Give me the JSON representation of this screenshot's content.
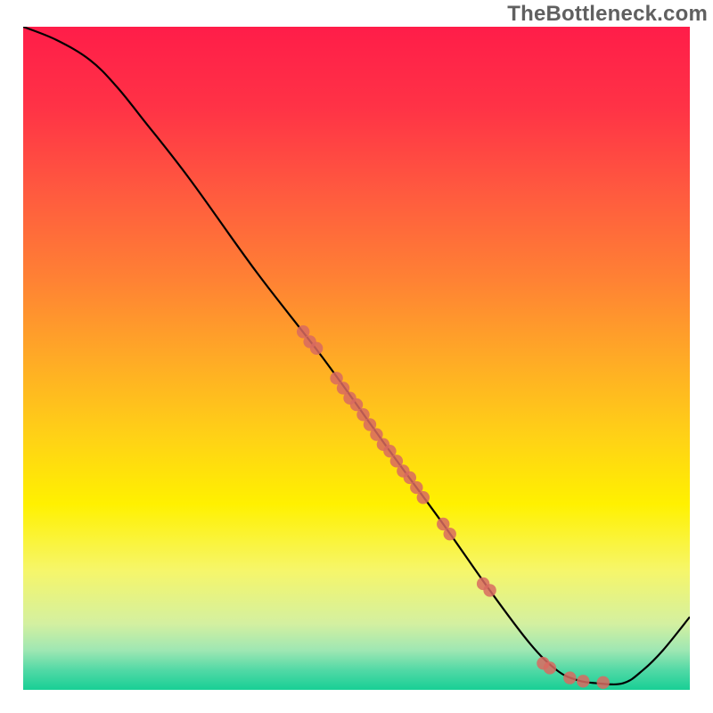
{
  "watermark": "TheBottleneck.com",
  "chart_data": {
    "type": "line",
    "title": "",
    "xlabel": "",
    "ylabel": "",
    "xlim": [
      0,
      100
    ],
    "ylim": [
      0,
      100
    ],
    "background": {
      "type": "vertical-gradient",
      "stops": [
        {
          "offset": 0.0,
          "color": "#ff1d49"
        },
        {
          "offset": 0.12,
          "color": "#ff3246"
        },
        {
          "offset": 0.25,
          "color": "#ff5a3f"
        },
        {
          "offset": 0.38,
          "color": "#ff8134"
        },
        {
          "offset": 0.5,
          "color": "#ffaa26"
        },
        {
          "offset": 0.62,
          "color": "#ffd216"
        },
        {
          "offset": 0.72,
          "color": "#fff100"
        },
        {
          "offset": 0.82,
          "color": "#f6f66a"
        },
        {
          "offset": 0.9,
          "color": "#d4f0a0"
        },
        {
          "offset": 0.94,
          "color": "#9fe7b3"
        },
        {
          "offset": 0.97,
          "color": "#52d9a6"
        },
        {
          "offset": 1.0,
          "color": "#18cf95"
        }
      ]
    },
    "series": [
      {
        "name": "bottleneck-curve",
        "type": "line",
        "color": "#000000",
        "points": [
          {
            "x": 0,
            "y": 100
          },
          {
            "x": 5,
            "y": 98
          },
          {
            "x": 10,
            "y": 95
          },
          {
            "x": 14,
            "y": 91
          },
          {
            "x": 18,
            "y": 86
          },
          {
            "x": 25,
            "y": 77
          },
          {
            "x": 35,
            "y": 63
          },
          {
            "x": 45,
            "y": 50
          },
          {
            "x": 55,
            "y": 36
          },
          {
            "x": 63,
            "y": 25
          },
          {
            "x": 70,
            "y": 15
          },
          {
            "x": 76,
            "y": 7
          },
          {
            "x": 80,
            "y": 3
          },
          {
            "x": 83,
            "y": 1.5
          },
          {
            "x": 86,
            "y": 1
          },
          {
            "x": 90,
            "y": 1
          },
          {
            "x": 93,
            "y": 3
          },
          {
            "x": 96,
            "y": 6
          },
          {
            "x": 100,
            "y": 11
          }
        ]
      },
      {
        "name": "sample-markers",
        "type": "scatter",
        "color": "#d86a60",
        "points": [
          {
            "x": 42,
            "y": 54
          },
          {
            "x": 43,
            "y": 52.5
          },
          {
            "x": 44,
            "y": 51.5
          },
          {
            "x": 47,
            "y": 47
          },
          {
            "x": 48,
            "y": 45.5
          },
          {
            "x": 49,
            "y": 44
          },
          {
            "x": 50,
            "y": 43
          },
          {
            "x": 51,
            "y": 41.5
          },
          {
            "x": 52,
            "y": 40
          },
          {
            "x": 53,
            "y": 38.5
          },
          {
            "x": 54,
            "y": 37
          },
          {
            "x": 55,
            "y": 36
          },
          {
            "x": 56,
            "y": 34.5
          },
          {
            "x": 57,
            "y": 33
          },
          {
            "x": 58,
            "y": 32
          },
          {
            "x": 59,
            "y": 30.5
          },
          {
            "x": 60,
            "y": 29
          },
          {
            "x": 63,
            "y": 25
          },
          {
            "x": 64,
            "y": 23.5
          },
          {
            "x": 69,
            "y": 16
          },
          {
            "x": 70,
            "y": 15
          },
          {
            "x": 78,
            "y": 4
          },
          {
            "x": 79,
            "y": 3.3
          },
          {
            "x": 82,
            "y": 1.8
          },
          {
            "x": 84,
            "y": 1.3
          },
          {
            "x": 87,
            "y": 1.1
          }
        ]
      }
    ]
  }
}
